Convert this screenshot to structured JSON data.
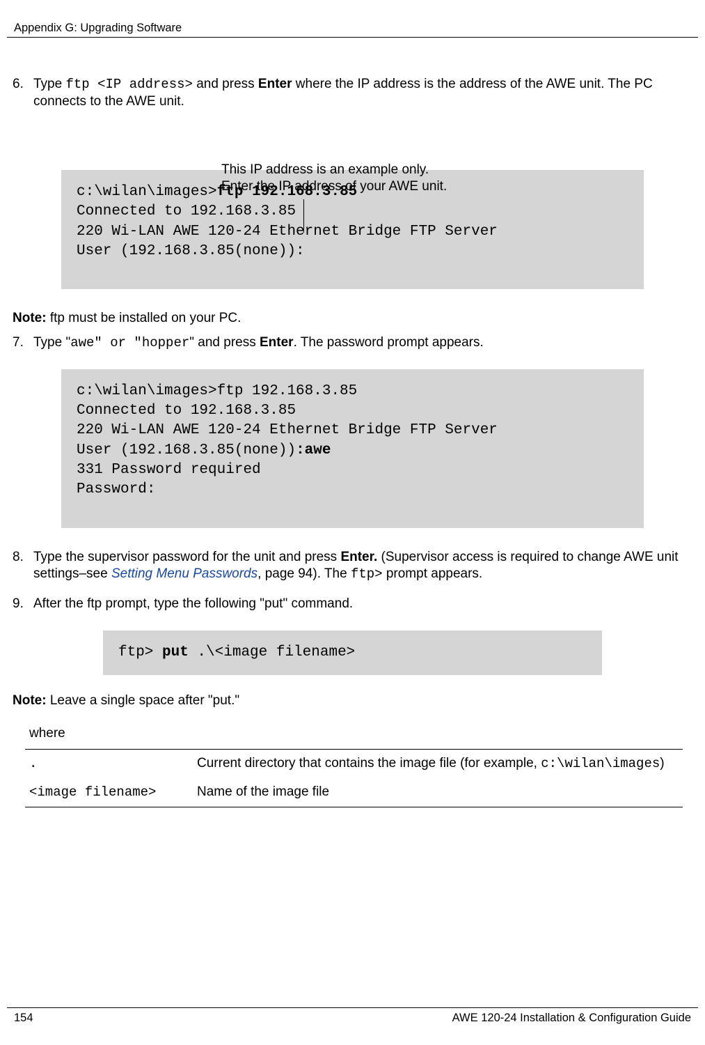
{
  "header": {
    "left": "Appendix G: Upgrading Software"
  },
  "step6": {
    "num": "6.",
    "pre": "Type ",
    "cmd": "ftp <IP address>",
    "mid": " and press ",
    "enter": "Enter",
    "post": " where the IP address is the address of the AWE unit. The PC connects to the AWE unit."
  },
  "callout": {
    "l1": "This IP address is an example only.",
    "l2": "Enter the IP address of your  AWE unit."
  },
  "code1": {
    "l1a": "c:\\wilan\\images>",
    "l1b": "ftp 192.168.3.85",
    "l2": "Connected to 192.168.3.85",
    "l3": "220 Wi-LAN AWE 120-24 Ethernet Bridge FTP Server",
    "l4": "User (192.168.3.85(none)):"
  },
  "note1": {
    "label": "Note: ",
    "text": "ftp must be installed on your PC."
  },
  "step7": {
    "num": "7.",
    "pre": "Type \"",
    "cmd1": "awe\" or \"hopper",
    "post1": "\" and press ",
    "enter": "Enter",
    "post2": ". The password prompt appears."
  },
  "code2": {
    "l1": "c:\\wilan\\images>ftp 192.168.3.85",
    "l2": "Connected to 192.168.3.85",
    "l3": "220 Wi-LAN AWE 120-24 Ethernet Bridge FTP Server",
    "l4a": "User (192.168.3.85(none))",
    "l4b": ":awe",
    "l5": "331 Password required",
    "l6": "Password:"
  },
  "step8": {
    "num": "8.",
    "pre": "Type the supervisor password for the unit and press ",
    "enter": "Enter.",
    "mid": " (Supervisor access is required to change AWE unit settings–see ",
    "link": "Setting Menu Passwords",
    "post1": ", page 94). The ",
    "code": "ftp>",
    "post2": " prompt appears."
  },
  "step9": {
    "num": "9.",
    "text": "After the ftp prompt, type the following \"put\" command."
  },
  "code3": {
    "l1a": "ftp> ",
    "l1b": "put",
    "l1c": " .\\<image filename>"
  },
  "note2": {
    "label": "Note: ",
    "text": "Leave a single space after \"put.\""
  },
  "where": "where",
  "defs": {
    "r1": {
      "k": " .",
      "v1": "Current directory that contains the image file (for example, ",
      "v2": "c:\\wilan\\images",
      "v3": ")"
    },
    "r2": {
      "k": "<image filename>",
      "v": "Name of the image file"
    }
  },
  "footer": {
    "page": "154",
    "title": "AWE 120-24 Installation & Configuration Guide"
  }
}
